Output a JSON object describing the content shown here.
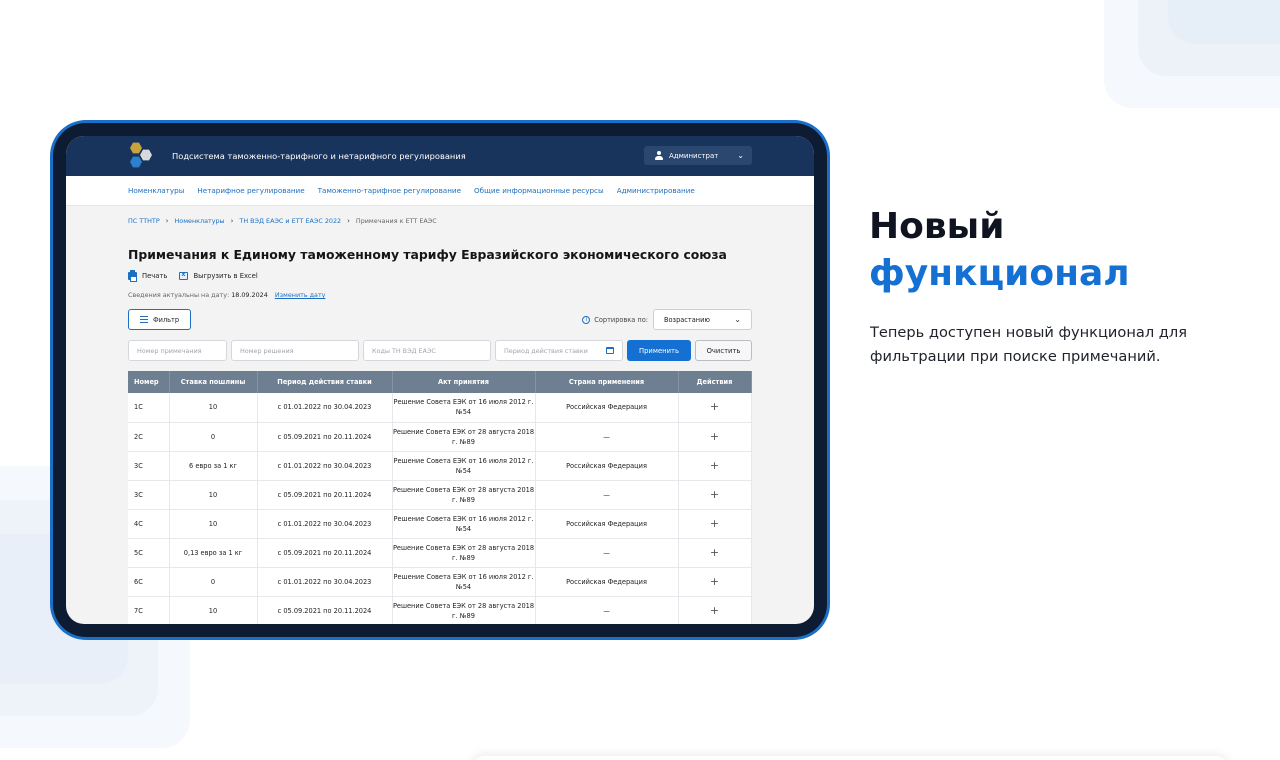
{
  "app": {
    "title": "Подсистема таможенно-тарифного и нетарифного регулирования",
    "user_label": "Администрат",
    "nav": [
      "Номенклатуры",
      "Нетарифное регулирование",
      "Таможенно-тарифное регулирование",
      "Общие информационные ресурсы",
      "Администрирование"
    ]
  },
  "breadcrumb": [
    "ПС ТТНТР",
    "Номенклатуры",
    "ТН ВЭД ЕАЭС и ЕТТ ЕАЭС 2022",
    "Примечания к ЕТТ ЕАЭС"
  ],
  "page": {
    "title": "Примечания к Единому таможенному тарифу Евразийского экономического союза",
    "print_label": "Печать",
    "excel_label": "Выгрузить в Excel",
    "date_prefix": "Сведения актуальны на дату:",
    "date": "18.09.2024",
    "change_date_label": "Изменить дату"
  },
  "filters": {
    "filter_button": "Фильтр",
    "sort_label": "Сортировка по:",
    "sort_value": "Возрастанию",
    "note_number_placeholder": "Номер примечания",
    "decision_number_placeholder": "Номер решения",
    "codes_placeholder": "Коды ТН ВЭД ЕАЭС",
    "period_placeholder": "Период действия ставки",
    "apply_label": "Применить",
    "clear_label": "Очистить"
  },
  "table": {
    "columns": [
      "Номер",
      "Ставка пошлины",
      "Период действия ставки",
      "Акт принятия",
      "Страна применения",
      "Действия"
    ],
    "rows": [
      [
        "1С",
        "10",
        "с 01.01.2022 по 30.04.2023",
        "Решение Совета ЕЭК от 16 июля 2012 г. №54",
        "Российская Федерация",
        "+"
      ],
      [
        "2С",
        "0",
        "с 05.09.2021 по 20.11.2024",
        "Решение Совета ЕЭК от 28 августа 2018 г. №89",
        "—",
        "+"
      ],
      [
        "3С",
        "6 евро за 1 кг",
        "с 01.01.2022 по 30.04.2023",
        "Решение Совета ЕЭК от 16 июля 2012 г. №54",
        "Российская Федерация",
        "+"
      ],
      [
        "3С",
        "10",
        "с 05.09.2021 по 20.11.2024",
        "Решение Совета ЕЭК от 28 августа 2018 г. №89",
        "—",
        "+"
      ],
      [
        "4С",
        "10",
        "с 01.01.2022 по 30.04.2023",
        "Решение Совета ЕЭК от 16 июля 2012 г. №54",
        "Российская Федерация",
        "+"
      ],
      [
        "5С",
        "0,13 евро за 1 кг",
        "с 05.09.2021 по 20.11.2024",
        "Решение Совета ЕЭК от 28 августа 2018 г. №89",
        "—",
        "+"
      ],
      [
        "6С",
        "0",
        "с 01.01.2022 по 30.04.2023",
        "Решение Совета ЕЭК от 16 июля 2012 г. №54",
        "Российская Федерация",
        "+"
      ],
      [
        "7С",
        "10",
        "с 05.09.2021 по 20.11.2024",
        "Решение Совета ЕЭК от 28 августа 2018 г. №89",
        "—",
        "+"
      ]
    ]
  },
  "promo": {
    "headline_line1": "Новый",
    "headline_line2": "функционал",
    "description": "Теперь доступен новый функционал для фильтрации при поиске примечаний."
  },
  "colors": {
    "accent": "#1470d2",
    "header_bg": "#18345c",
    "table_header_bg": "#6e7f91"
  }
}
